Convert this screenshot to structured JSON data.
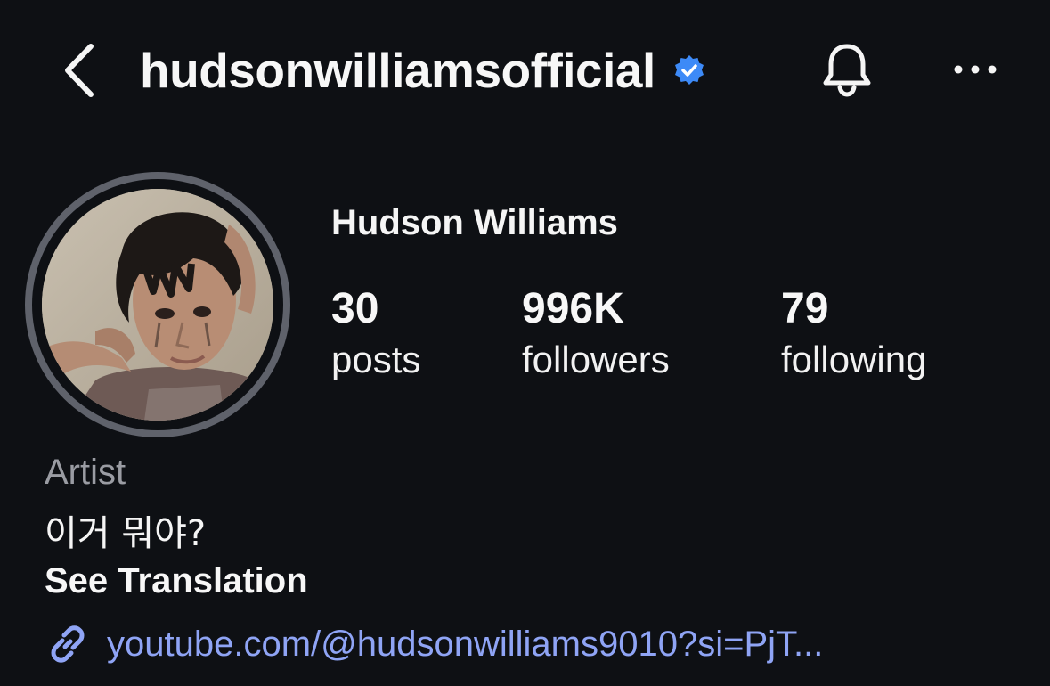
{
  "header": {
    "back_icon": "chevron-left-icon",
    "username": "hudsonwilliamsofficial",
    "verified_icon": "verified-badge-icon",
    "bell_icon": "bell-icon",
    "more_icon": "more-horizontal-icon"
  },
  "profile": {
    "avatar_description_icon": "profile-photo",
    "display_name": "Hudson Williams",
    "stats": [
      {
        "value": "30",
        "label": "posts"
      },
      {
        "value": "996K",
        "label": "followers"
      },
      {
        "value": "79",
        "label": "following"
      }
    ],
    "category": "Artist",
    "bio": "이거 뭐야?",
    "translate_label": "See Translation",
    "link_icon": "link-icon",
    "link": "youtube.com/@hudsonwilliams9010?si=PjT..."
  },
  "colors": {
    "background": "#0e1014",
    "verified": "#3d8af7",
    "link": "#8fa4f5",
    "muted": "#9a9ca3"
  }
}
